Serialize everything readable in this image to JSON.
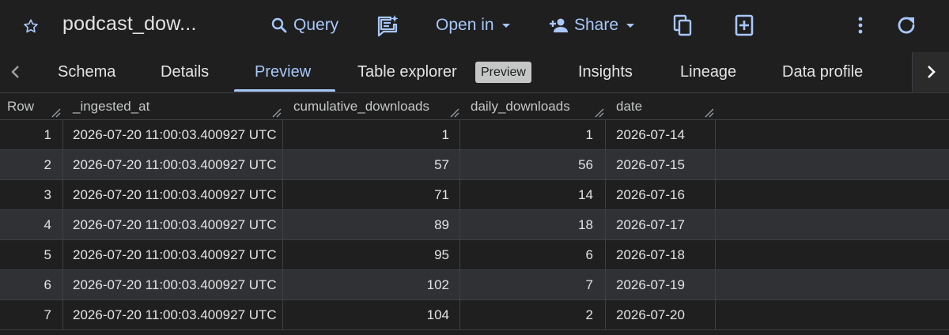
{
  "toolbar": {
    "title": "podcast_dow...",
    "query_label": "Query",
    "open_in_label": "Open in",
    "share_label": "Share",
    "icons": {
      "star": "star-outline-icon",
      "query": "search-icon",
      "compose": "compose-sparkle-icon",
      "open_in": "caret-down-icon",
      "share": "person-add-icon",
      "copy": "copy-icon",
      "add": "add-box-icon",
      "more": "more-vert-icon",
      "refresh": "refresh-icon"
    }
  },
  "tabs": {
    "items": [
      "Schema",
      "Details",
      "Preview",
      "Table explorer",
      "Insights",
      "Lineage",
      "Data profile"
    ],
    "active": "Preview",
    "badge": "Preview"
  },
  "table": {
    "columns": [
      "Row",
      "_ingested_at",
      "cumulative_downloads",
      "daily_downloads",
      "date"
    ],
    "rows": [
      [
        "1",
        "2026-07-20 11:00:03.400927 UTC",
        "1",
        "1",
        "2026-07-14"
      ],
      [
        "2",
        "2026-07-20 11:00:03.400927 UTC",
        "57",
        "56",
        "2026-07-15"
      ],
      [
        "3",
        "2026-07-20 11:00:03.400927 UTC",
        "71",
        "14",
        "2026-07-16"
      ],
      [
        "4",
        "2026-07-20 11:00:03.400927 UTC",
        "89",
        "18",
        "2026-07-17"
      ],
      [
        "5",
        "2026-07-20 11:00:03.400927 UTC",
        "95",
        "6",
        "2026-07-18"
      ],
      [
        "6",
        "2026-07-20 11:00:03.400927 UTC",
        "102",
        "7",
        "2026-07-19"
      ],
      [
        "7",
        "2026-07-20 11:00:03.400927 UTC",
        "104",
        "2",
        "2026-07-20"
      ]
    ]
  },
  "colors": {
    "background": "#1f1f1f",
    "row_alt": "#303134",
    "accent": "#a8c7fa",
    "text": "#e3e3e3",
    "border": "#3c4043"
  }
}
